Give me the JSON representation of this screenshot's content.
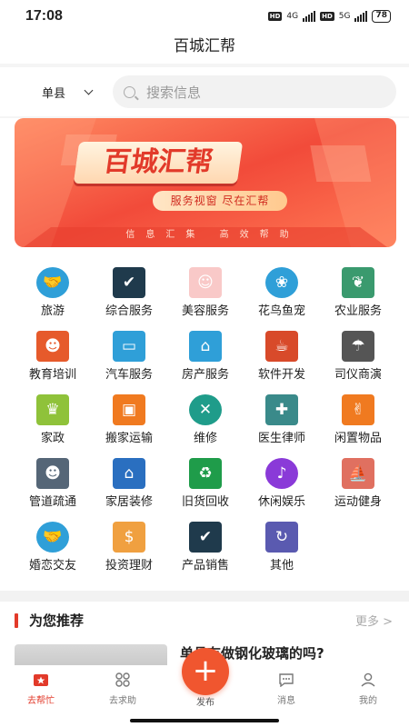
{
  "status": {
    "time": "17:08",
    "net1": "4G",
    "net2": "5G",
    "hd": "HD",
    "battery": "78"
  },
  "app_title": "百城汇帮",
  "region": "单县",
  "search": {
    "placeholder": "搜索信息"
  },
  "banner": {
    "title": "百城汇帮",
    "pill": "服务视窗 尽在汇帮",
    "bottom": "信息汇集 高效帮助"
  },
  "categories": [
    {
      "label": "旅游",
      "icon": "handshake-icon",
      "color": "#2f9fd8"
    },
    {
      "label": "综合服务",
      "icon": "hand-gift-icon",
      "color": "#1f3a4c"
    },
    {
      "label": "美容服务",
      "icon": "face-icon",
      "color": "#f9c9c8"
    },
    {
      "label": "花鸟鱼宠",
      "icon": "paw-icon",
      "color": "#2f9fd8"
    },
    {
      "label": "农业服务",
      "icon": "wheat-icon",
      "color": "#3a9a6e"
    },
    {
      "label": "教育培训",
      "icon": "people-circle-icon",
      "color": "#e65a2b"
    },
    {
      "label": "汽车服务",
      "icon": "car-icon",
      "color": "#2f9fd8"
    },
    {
      "label": "房产服务",
      "icon": "house-icon",
      "color": "#2f9fd8"
    },
    {
      "label": "软件开发",
      "icon": "java-icon",
      "color": "#d84a2a"
    },
    {
      "label": "司仪商演",
      "icon": "stage-icon",
      "color": "#555555"
    },
    {
      "label": "家政",
      "icon": "maid-icon",
      "color": "#8fc23a"
    },
    {
      "label": "搬家运输",
      "icon": "truck-icon",
      "color": "#f07a20"
    },
    {
      "label": "维修",
      "icon": "wrench-icon",
      "color": "#1f9c8a"
    },
    {
      "label": "医生律师",
      "icon": "doctor-icon",
      "color": "#3a8a8a"
    },
    {
      "label": "闲置物品",
      "icon": "victory-hand-icon",
      "color": "#f07a20"
    },
    {
      "label": "管道疏通",
      "icon": "worker-icon",
      "color": "#556677"
    },
    {
      "label": "家居装修",
      "icon": "home-sign-icon",
      "color": "#2a6fc0"
    },
    {
      "label": "旧货回收",
      "icon": "recycle-icon",
      "color": "#1f9c4a"
    },
    {
      "label": "休闲娱乐",
      "icon": "microphone-icon",
      "color": "#8a3ad8"
    },
    {
      "label": "运动健身",
      "icon": "sailboat-icon",
      "color": "#e07060"
    },
    {
      "label": "婚恋交友",
      "icon": "handshake-icon",
      "color": "#2f9fd8"
    },
    {
      "label": "投资理财",
      "icon": "piggy-bank-icon",
      "color": "#f0a040"
    },
    {
      "label": "产品销售",
      "icon": "hand-gift-icon",
      "color": "#1f3a4c"
    },
    {
      "label": "其他",
      "icon": "refresh-icon",
      "color": "#5a5ab0"
    }
  ],
  "recommend": {
    "title": "为您推荐",
    "more": "更多 >",
    "first_item": "单县有做钢化玻璃的吗?"
  },
  "tabs": [
    {
      "label": "去帮忙",
      "icon": "star-badge-icon"
    },
    {
      "label": "去求助",
      "icon": "grid-circles-icon"
    },
    {
      "label": "发布",
      "icon": "plus-icon"
    },
    {
      "label": "消息",
      "icon": "chat-icon"
    },
    {
      "label": "我的",
      "icon": "person-icon"
    }
  ],
  "accent": "#e23a2a"
}
